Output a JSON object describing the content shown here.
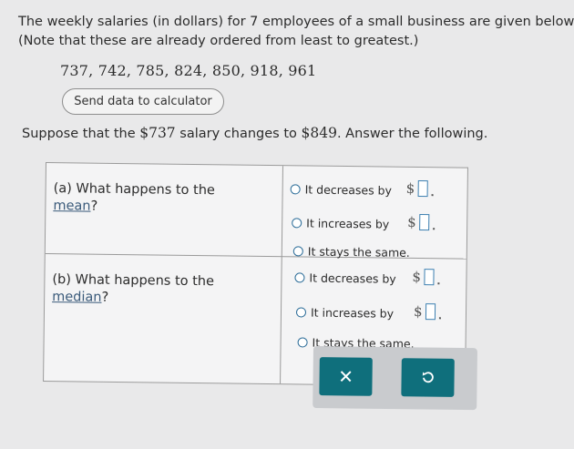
{
  "intro": {
    "line1": "The weekly salaries (in dollars) for 7 employees of a small business are given below.",
    "line2": "(Note that these are already ordered from least to greatest.)"
  },
  "dataset": "737, 742, 785, 824, 850, 918, 961",
  "send_button": "Send data to calculator",
  "suppose": {
    "prefix": "Suppose that the ",
    "from": "$737",
    "middle": " salary changes to ",
    "to": "$849",
    "suffix": ". Answer the following."
  },
  "part_a": {
    "label": "(a)  What happens to the",
    "link": "mean",
    "end": "?",
    "options": [
      "It decreases by",
      "It increases by",
      "It stays the same."
    ]
  },
  "part_b": {
    "label": "(b)  What happens to the",
    "link": "median",
    "end": "?",
    "options": [
      "It decreases by",
      "It increases by",
      "It stays the same."
    ]
  },
  "currency_symbol": "$",
  "actions": {
    "clear_symbol": "✕"
  },
  "colors": {
    "accent": "#0f6f7c",
    "radio": "#2f6f9a",
    "link": "#3a5a7a"
  },
  "icons": [
    "radio-icon",
    "close-icon",
    "undo-icon"
  ]
}
